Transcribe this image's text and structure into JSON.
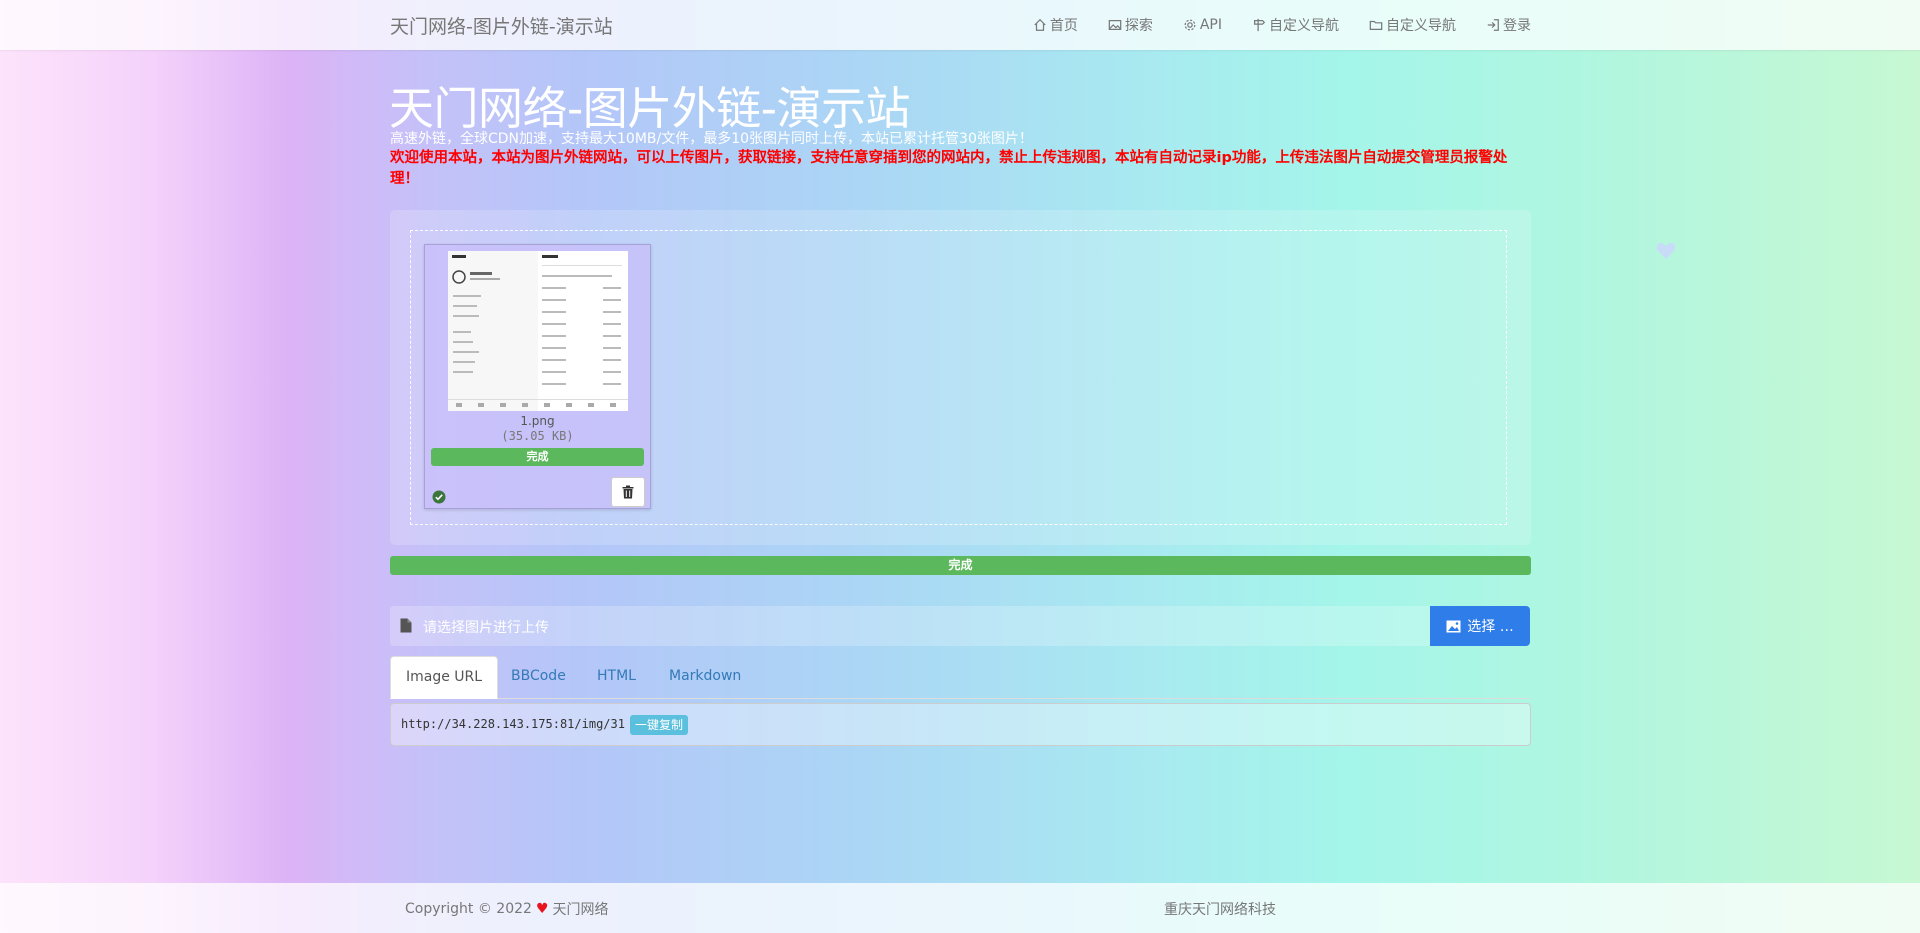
{
  "navbar": {
    "brand": "天门网络-图片外链-演示站",
    "items": [
      {
        "label": "首页",
        "icon": "home-icon"
      },
      {
        "label": "探索",
        "icon": "image-icon"
      },
      {
        "label": "API",
        "icon": "gear-icon"
      },
      {
        "label": "自定义导航",
        "icon": "signpost-icon"
      },
      {
        "label": "自定义导航",
        "icon": "folder-icon"
      },
      {
        "label": "登录",
        "icon": "login-icon"
      }
    ]
  },
  "hero": {
    "title": "天门网络-图片外链-演示站",
    "subtitle": "高速外链，全球CDN加速，支持最大10MB/文件，最多10张图片同时上传，本站已累计托管30张图片！",
    "warning": "欢迎使用本站，本站为图片外链网站，可以上传图片，获取链接，支持任意穿插到您的网站内，禁止上传违规图，本站有自动记录ip功能，上传违法图片自动提交管理员报警处理！"
  },
  "upload": {
    "file": {
      "name": "1.png",
      "size": "(35.05 KB)",
      "status": "完成",
      "progress": 100
    },
    "total_status": "完成",
    "total_progress": 100,
    "placeholder": "请选择图片进行上传",
    "select_label": "选择 …"
  },
  "tabs": [
    "Image URL",
    "BBCode",
    "HTML",
    "Markdown"
  ],
  "result": {
    "url": "http://34.228.143.175:81/img/31",
    "copy_label": "一键复制"
  },
  "footer": {
    "copyright": "Copyright © 2022",
    "brand": "天门网络",
    "company": "重庆天门网络科技"
  },
  "colors": {
    "success": "#5cb85c",
    "primary": "#2e7de9",
    "info": "#5bc0de",
    "warning_text": "#ff0000"
  }
}
